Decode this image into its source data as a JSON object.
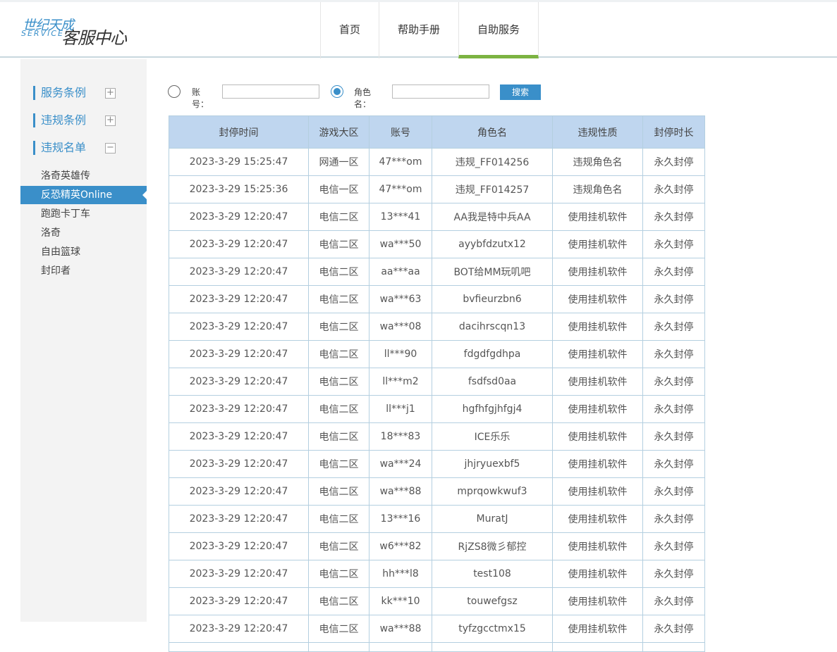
{
  "logo": {
    "line1": "世纪天成",
    "line2": "SERVICE",
    "line3": "客服中心"
  },
  "nav": [
    {
      "label": "首页"
    },
    {
      "label": "帮助手册"
    },
    {
      "label": "自助服务",
      "active": true
    }
  ],
  "sidebar": {
    "categories": [
      {
        "label": "服务条例",
        "toggle": "+"
      },
      {
        "label": "违规条例",
        "toggle": "+"
      },
      {
        "label": "违规名单",
        "toggle": "−"
      }
    ],
    "games": [
      "洛奇英雄传",
      "反恐精英Online",
      "跑跑卡丁车",
      "洛奇",
      "自由篮球",
      "封印者"
    ],
    "active_game": "反恐精英Online"
  },
  "search": {
    "account_label": "账号：",
    "role_label": "角色名：",
    "button": "搜索",
    "selected": "role"
  },
  "table": {
    "headers": [
      "封停时间",
      "游戏大区",
      "账号",
      "角色名",
      "违规性质",
      "封停时长"
    ],
    "rows": [
      [
        "2023-3-29 15:25:47",
        "网通一区",
        "47***om",
        "违规_FF014256",
        "违规角色名",
        "永久封停"
      ],
      [
        "2023-3-29 15:25:36",
        "电信一区",
        "47***om",
        "违规_FF014257",
        "违规角色名",
        "永久封停"
      ],
      [
        "2023-3-29 12:20:47",
        "电信二区",
        "13***41",
        "AA我是特中兵AA",
        "使用挂机软件",
        "永久封停"
      ],
      [
        "2023-3-29 12:20:47",
        "电信二区",
        "wa***50",
        "ayybfdzutx12",
        "使用挂机软件",
        "永久封停"
      ],
      [
        "2023-3-29 12:20:47",
        "电信二区",
        "aa***aa",
        "BOT给MM玩叽吧",
        "使用挂机软件",
        "永久封停"
      ],
      [
        "2023-3-29 12:20:47",
        "电信二区",
        "wa***63",
        "bvfieurzbn6",
        "使用挂机软件",
        "永久封停"
      ],
      [
        "2023-3-29 12:20:47",
        "电信二区",
        "wa***08",
        "dacihrscqn13",
        "使用挂机软件",
        "永久封停"
      ],
      [
        "2023-3-29 12:20:47",
        "电信二区",
        "ll***90",
        "fdgdfgdhpa",
        "使用挂机软件",
        "永久封停"
      ],
      [
        "2023-3-29 12:20:47",
        "电信二区",
        "ll***m2",
        "fsdfsd0aa",
        "使用挂机软件",
        "永久封停"
      ],
      [
        "2023-3-29 12:20:47",
        "电信二区",
        "ll***j1",
        "hgfhfgjhfgj4",
        "使用挂机软件",
        "永久封停"
      ],
      [
        "2023-3-29 12:20:47",
        "电信二区",
        "18***83",
        "ICE乐乐",
        "使用挂机软件",
        "永久封停"
      ],
      [
        "2023-3-29 12:20:47",
        "电信二区",
        "wa***24",
        "jhjryuexbf5",
        "使用挂机软件",
        "永久封停"
      ],
      [
        "2023-3-29 12:20:47",
        "电信二区",
        "wa***88",
        "mprqowkwuf3",
        "使用挂机软件",
        "永久封停"
      ],
      [
        "2023-3-29 12:20:47",
        "电信二区",
        "13***16",
        "MuratJ",
        "使用挂机软件",
        "永久封停"
      ],
      [
        "2023-3-29 12:20:47",
        "电信二区",
        "w6***82",
        "RjZS8微彡郁控",
        "使用挂机软件",
        "永久封停"
      ],
      [
        "2023-3-29 12:20:47",
        "电信二区",
        "hh***l8",
        "test108",
        "使用挂机软件",
        "永久封停"
      ],
      [
        "2023-3-29 12:20:47",
        "电信二区",
        "kk***10",
        "touwefgsz",
        "使用挂机软件",
        "永久封停"
      ],
      [
        "2023-3-29 12:20:47",
        "电信二区",
        "wa***88",
        "tyfzgcctmx15",
        "使用挂机软件",
        "永久封停"
      ]
    ]
  },
  "colors": {
    "accent": "#3a8fc9",
    "nav_active": "#7cb342",
    "table_header": "#bfd6ef"
  }
}
